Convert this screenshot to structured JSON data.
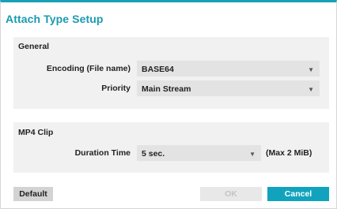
{
  "dialog": {
    "title": "Attach Type Setup"
  },
  "general": {
    "title": "General",
    "encoding": {
      "label": "Encoding (File name)",
      "value": "BASE64"
    },
    "priority": {
      "label": "Priority",
      "value": "Main Stream"
    }
  },
  "mp4": {
    "title": "MP4 Clip",
    "duration": {
      "label": "Duration Time",
      "value": "5 sec.",
      "hint": "(Max 2 MiB)"
    }
  },
  "buttons": {
    "default_label": "Default",
    "ok_label": "OK",
    "cancel_label": "Cancel"
  },
  "colors": {
    "accent": "#1a9ab0",
    "cancel_bg": "#11a3bd"
  },
  "icons": {
    "dropdown": "chevron-down-icon"
  }
}
